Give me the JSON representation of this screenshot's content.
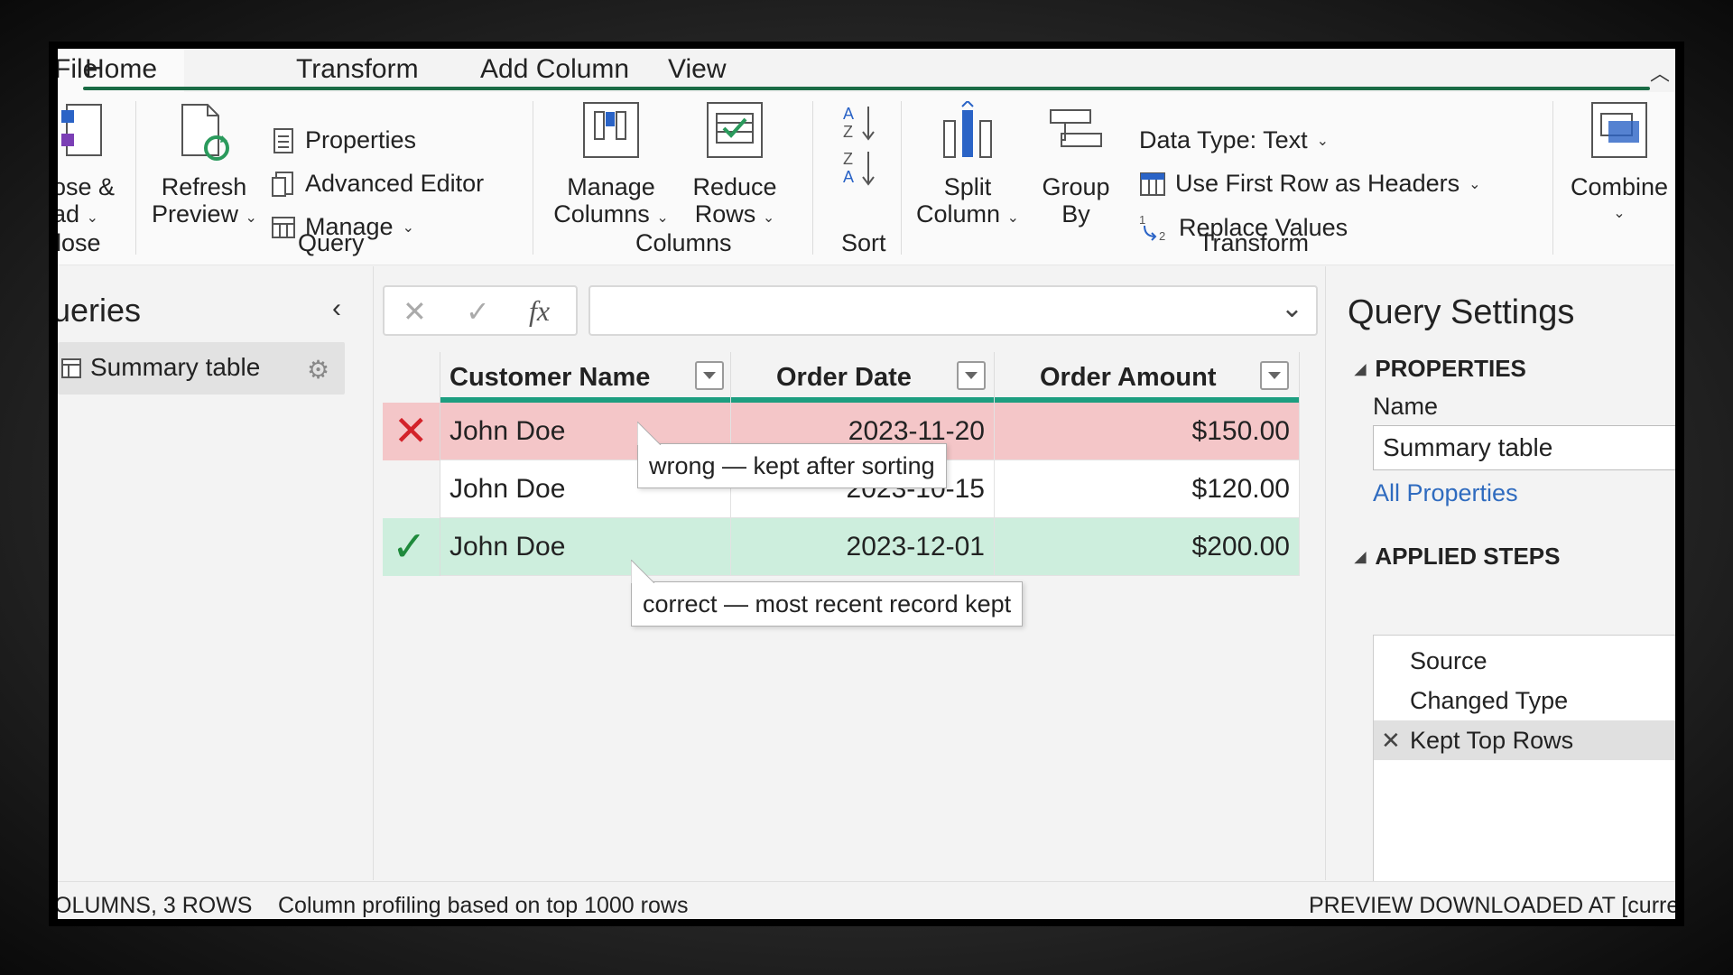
{
  "tabs": {
    "file": "File",
    "home": "Home",
    "transform": "Transform",
    "add_column": "Add Column",
    "view": "View"
  },
  "ribbon": {
    "close_load": {
      "line1": "ose &",
      "line2": "ad"
    },
    "refresh": {
      "line1": "Refresh",
      "line2": "Preview"
    },
    "properties": "Properties",
    "advanced_editor": "Advanced Editor",
    "manage": "Manage",
    "manage_columns": {
      "line1": "Manage",
      "line2": "Columns"
    },
    "reduce_rows": {
      "line1": "Reduce",
      "line2": "Rows"
    },
    "split_column": {
      "line1": "Split",
      "line2": "Column"
    },
    "group_by": {
      "line1": "Group",
      "line2": "By"
    },
    "data_type": "Data Type: Text",
    "first_row_headers": "Use First Row as Headers",
    "replace_values": "Replace Values",
    "combine": "Combine",
    "groups": {
      "close": "lose",
      "query": "Query",
      "columns": "Columns",
      "sort": "Sort",
      "transform": "Transform"
    }
  },
  "queries": {
    "title": "ueries",
    "item": "Summary table"
  },
  "formula_bar": {
    "fx": "fx",
    "value": ""
  },
  "grid": {
    "headers": [
      "Customer Name",
      "Order Date",
      "Order Amount"
    ],
    "rows": [
      {
        "name": "John Doe",
        "date": "2023-11-20",
        "amount": "$150.00",
        "status": "wrong"
      },
      {
        "name": "John Doe",
        "date": "2023-10-15",
        "amount": "$120.00",
        "status": "neutral"
      },
      {
        "name": "John Doe",
        "date": "2023-12-01",
        "amount": "$200.00",
        "status": "correct"
      }
    ],
    "callout_wrong": "wrong — kept after sorting",
    "callout_correct": "correct — most recent record kept"
  },
  "settings": {
    "title": "Query Settings",
    "properties_heading": "PROPERTIES",
    "name_label": "Name",
    "name_value": "Summary table",
    "all_properties": "All Properties",
    "applied_steps_heading": "APPLIED STEPS",
    "steps": [
      "Source",
      "Changed Type",
      "Kept Top Rows"
    ]
  },
  "status": {
    "left": "OLUMNS, 3 ROWS",
    "profiling": "Column profiling based on top 1000 rows",
    "right": "PREVIEW DOWNLOADED AT [curren"
  },
  "colors": {
    "accent": "#1a6b45",
    "header_bar": "#1d9e80",
    "wrong_row": "#f4c6c8",
    "correct_row": "#cdeedd",
    "wrong_mark": "#d3222a",
    "correct_mark": "#1f8a3c",
    "link": "#2f6bbf"
  }
}
